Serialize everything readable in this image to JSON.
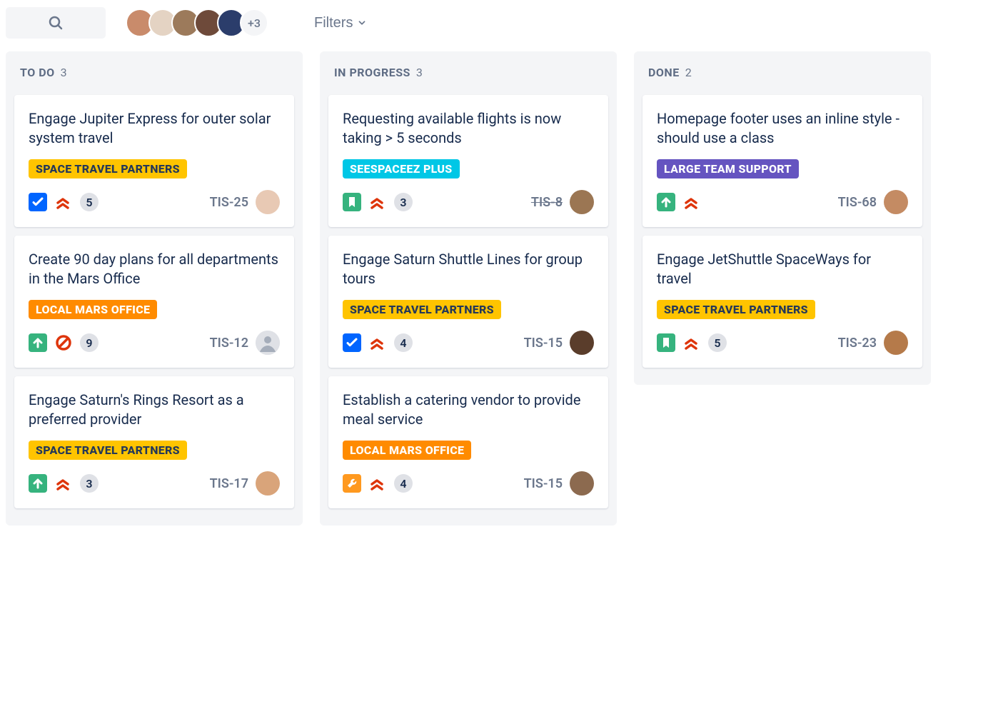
{
  "toolbar": {
    "search_placeholder": "Search",
    "avatar_overflow": "+3",
    "filters_label": "Filters"
  },
  "columns": [
    {
      "title": "TO DO",
      "count": "3",
      "cards": [
        {
          "title": "Engage Jupiter Express for outer solar system travel",
          "epic": "SPACE TRAVEL PARTNERS",
          "epic_color": "yellow",
          "type": "task",
          "priority": "highest",
          "points": "5",
          "key": "TIS-25",
          "key_done": false,
          "assignee": "user-a",
          "assignee_color": "#e8c9b4"
        },
        {
          "title": "Create 90 day plans for all departments in the Mars Office",
          "epic": "LOCAL MARS OFFICE",
          "epic_color": "orange",
          "type": "subtask",
          "priority": "blocker",
          "points": "9",
          "key": "TIS-12",
          "key_done": false,
          "assignee": null
        },
        {
          "title": "Engage Saturn's Rings Resort as a preferred provider",
          "epic": "SPACE TRAVEL PARTNERS",
          "epic_color": "yellow",
          "type": "subtask",
          "priority": "highest",
          "points": "3",
          "key": "TIS-17",
          "key_done": false,
          "assignee": "user-b",
          "assignee_color": "#d9a47a"
        }
      ]
    },
    {
      "title": "IN PROGRESS",
      "count": "3",
      "cards": [
        {
          "title": "Requesting available flights is now taking > 5 seconds",
          "epic": "SEESPACEEZ PLUS",
          "epic_color": "teal",
          "type": "story",
          "priority": "highest",
          "points": "3",
          "key": "TIS-8",
          "key_done": true,
          "assignee": "user-c",
          "assignee_color": "#9b7653"
        },
        {
          "title": "Engage Saturn Shuttle Lines for group tours",
          "epic": "SPACE TRAVEL PARTNERS",
          "epic_color": "yellow",
          "type": "task",
          "priority": "highest",
          "points": "4",
          "key": "TIS-15",
          "key_done": false,
          "assignee": "user-d",
          "assignee_color": "#5a3d2b"
        },
        {
          "title": "Establish a catering vendor to provide meal service",
          "epic": "LOCAL MARS OFFICE",
          "epic_color": "orange",
          "type": "ops",
          "priority": "highest",
          "points": "4",
          "key": "TIS-15",
          "key_done": false,
          "assignee": "user-e",
          "assignee_color": "#8c6a4f"
        }
      ]
    },
    {
      "title": "DONE",
      "count": "2",
      "cards": [
        {
          "title": "Homepage footer uses an inline style - should use a class",
          "epic": "LARGE TEAM SUPPORT",
          "epic_color": "purple",
          "type": "subtask",
          "priority": "highest",
          "points": null,
          "key": "TIS-68",
          "key_done": false,
          "assignee": "user-f",
          "assignee_color": "#c48b63"
        },
        {
          "title": "Engage JetShuttle SpaceWays for travel",
          "epic": "SPACE TRAVEL PARTNERS",
          "epic_color": "yellow",
          "type": "story",
          "priority": "highest",
          "points": "5",
          "key": "TIS-23",
          "key_done": false,
          "assignee": "user-g",
          "assignee_color": "#b57a4a"
        }
      ]
    }
  ]
}
